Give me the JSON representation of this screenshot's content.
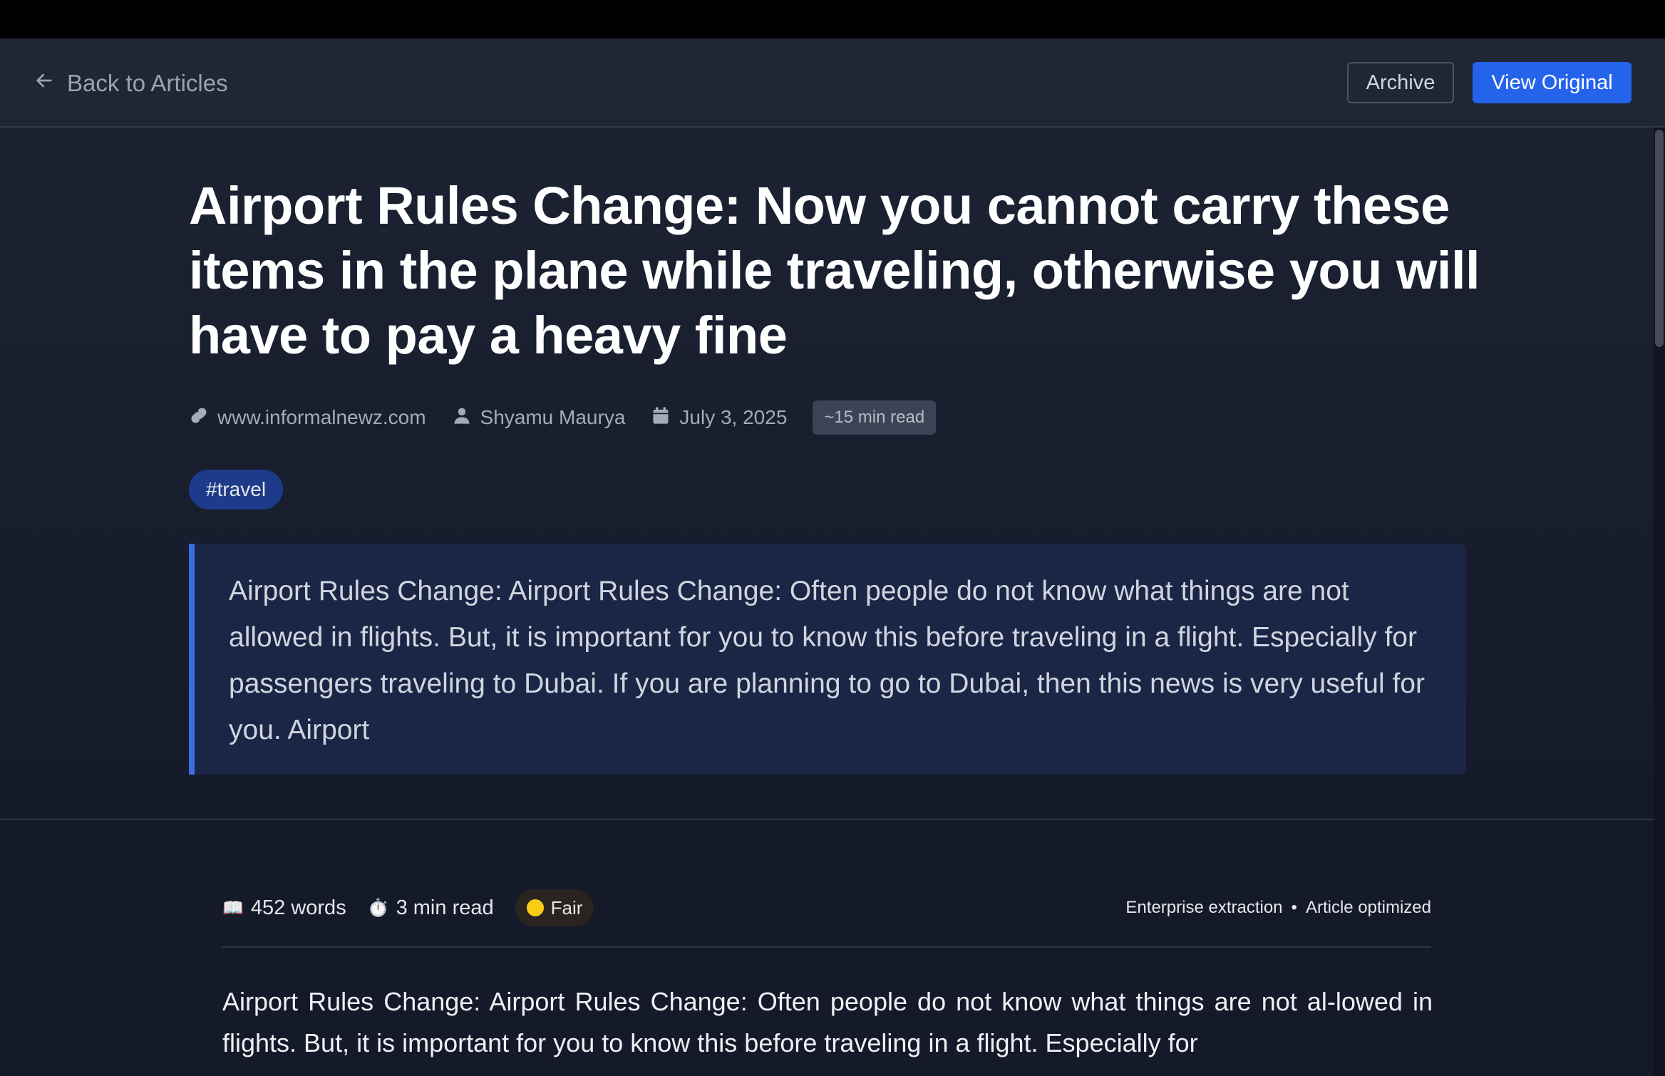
{
  "header": {
    "back_label": "Back to Articles",
    "archive_label": "Archive",
    "view_original_label": "View Original"
  },
  "article": {
    "title": "Airport Rules Change: Now you cannot carry these items in the plane while traveling, otherwise you will have to pay a heavy fine",
    "source": "www.informalnewz.com",
    "author": "Shyamu Maurya",
    "date": "July 3, 2025",
    "read_estimate": "~15 min read",
    "tag": "#travel",
    "excerpt": "Airport Rules Change: Airport Rules Change: Often people do not know what things are not allowed in flights. But, it is important for you to know this before traveling in a flight. Especially for passengers traveling to Dubai. If you are planning to go to Dubai, then this news is very useful for you. Airport"
  },
  "stats": {
    "words_icon": "📖",
    "words": "452 words",
    "time_icon": "⏱️",
    "read_time": "3 min read",
    "quality": "Fair",
    "quality_color": "#facc15",
    "extraction": "Enterprise extraction",
    "separator": "•",
    "optimized": "Article optimized"
  },
  "content": {
    "body": "Airport Rules Change: Airport Rules Change: Often people do not know what things are not al-lowed in flights. But, it is important for you to know this before traveling in a flight. Especially for"
  },
  "icons": {
    "back": "arrow-left-icon",
    "source": "link-icon",
    "author": "user-icon",
    "date": "calendar-icon"
  },
  "colors": {
    "accent": "#2563eb",
    "excerpt_border": "#3b6fe0",
    "tag_bg": "#1e3a8a"
  }
}
